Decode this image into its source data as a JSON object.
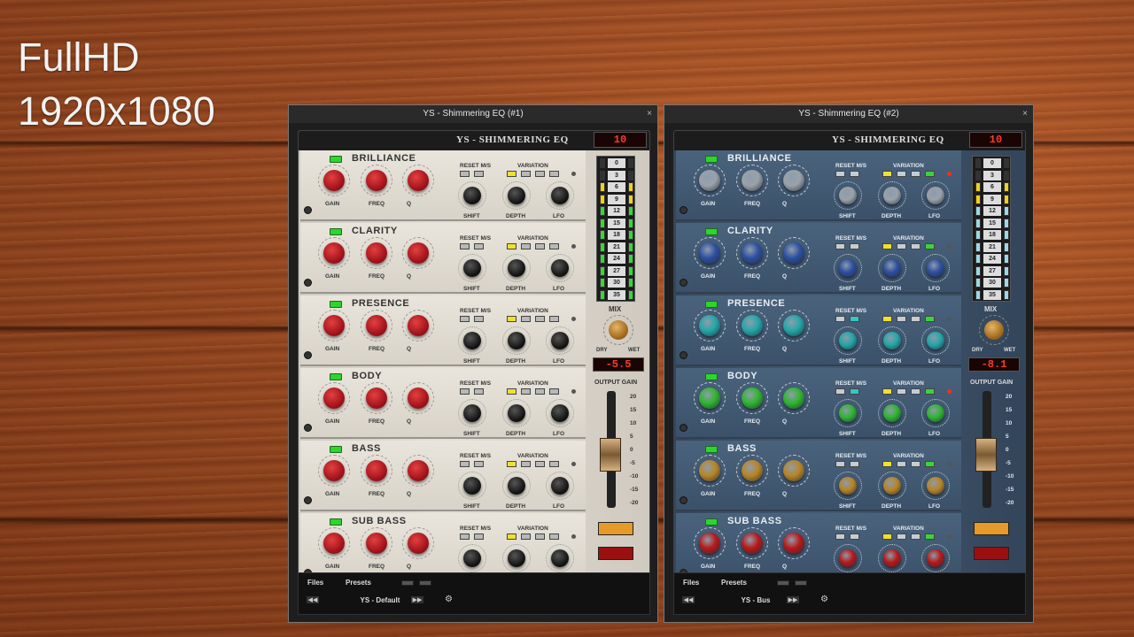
{
  "overlay": {
    "line1": "FullHD",
    "line2": "1920x1080"
  },
  "windows": [
    {
      "title": "YS - Shimmering EQ (#1)",
      "plugin_title": "YS - SHIMMERING EQ",
      "top_value": "10",
      "mix_value": "-5.5",
      "preset": "YS - Default",
      "theme": "classic"
    },
    {
      "title": "YS - Shimmering EQ (#2)",
      "plugin_title": "YS - SHIMMERING EQ",
      "top_value": "10",
      "mix_value": "-8.1",
      "preset": "YS - Bus",
      "theme": "blue"
    }
  ],
  "bands": [
    "BRILLIANCE",
    "CLARITY",
    "PRESENCE",
    "BODY",
    "BASS",
    "SUB BASS"
  ],
  "labels": {
    "gain": "GAIN",
    "freq": "FREQ",
    "q": "Q",
    "shift": "SHIFT",
    "depth": "DEPTH",
    "lfo": "LFO",
    "reset": "RESET",
    "ms": "M/S",
    "variation": "VARIATION",
    "mix": "MIX",
    "dry": "DRY",
    "wet": "WET",
    "output_gain": "OUTPUT GAIN",
    "files": "Files",
    "presets": "Presets"
  },
  "meter_scale": [
    "0",
    "3",
    "6",
    "9",
    "12",
    "15",
    "18",
    "21",
    "24",
    "27",
    "30",
    "35"
  ],
  "fader_scale": [
    "20",
    "15",
    "10",
    "5",
    "0",
    "-5",
    "-10",
    "-15",
    "-20"
  ],
  "colors": {
    "blue_theme_knobs": [
      "#9aa2aa",
      "#2d4fa0",
      "#23a7a7",
      "#2fb52f",
      "#b98424",
      "#b81818"
    ]
  }
}
